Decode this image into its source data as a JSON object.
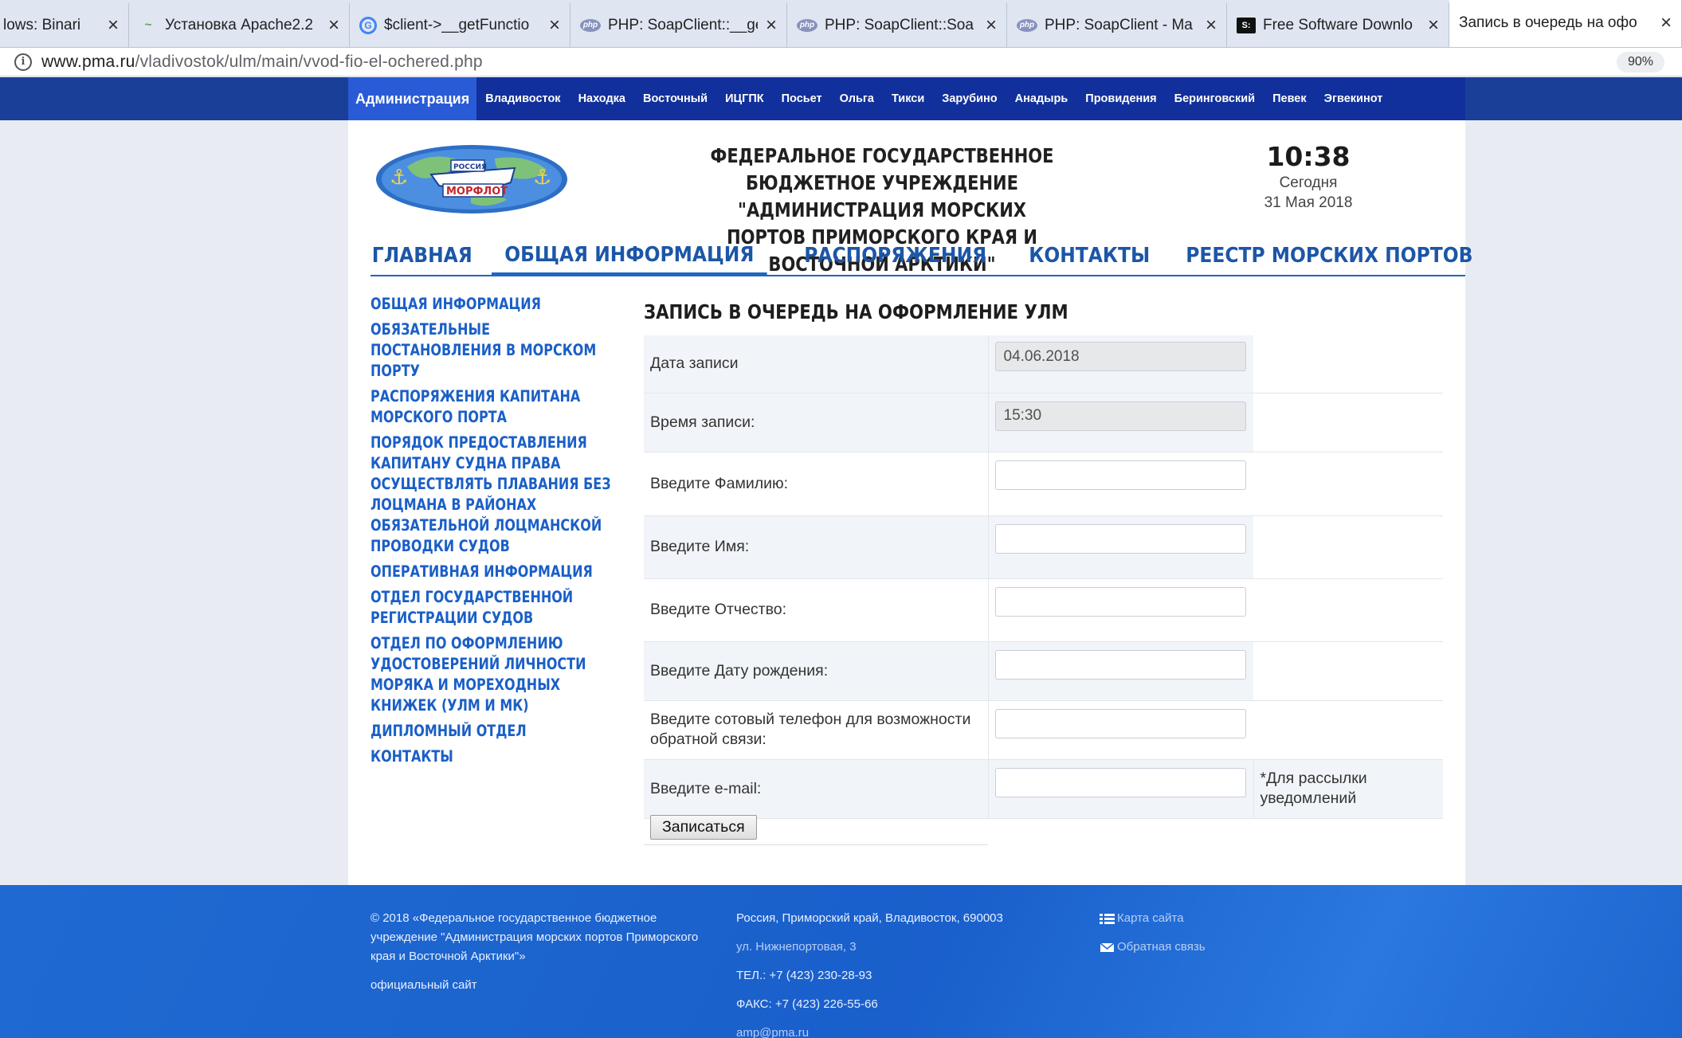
{
  "browser": {
    "tabs": [
      {
        "label": "lows: Binari",
        "favicon": "windows-icon"
      },
      {
        "label": "Установка Apache2.2",
        "favicon": "dash-icon"
      },
      {
        "label": "$client->__getFunctio",
        "favicon": "google-icon"
      },
      {
        "label": "PHP: SoapClient::__ge",
        "favicon": "php-icon"
      },
      {
        "label": "PHP: SoapClient::Soa",
        "favicon": "php-icon"
      },
      {
        "label": "PHP: SoapClient - Ma",
        "favicon": "php-icon"
      },
      {
        "label": "Free Software Downlo",
        "favicon": "sf-icon"
      },
      {
        "label": "Запись в очередь на офо",
        "favicon": "none",
        "active": true
      }
    ],
    "favicon_text": {
      "php": "php",
      "google": "G",
      "sf": "S:"
    },
    "url_host": "www.pma.ru",
    "url_path": "/vladivostok/ulm/main/vvod-fio-el-ochered.php",
    "zoom": "90%"
  },
  "site": {
    "cities": [
      "Администрация",
      "Владивосток",
      "Находка",
      "Восточный",
      "ИЦГПК",
      "Посьет",
      "Ольга",
      "Тикси",
      "Зарубино",
      "Анадырь",
      "Провидения",
      "Беринговский",
      "Певек",
      "Эгвекинот"
    ],
    "logo_text": {
      "top": "РОССИЯ",
      "bottom": "МОРФЛОТ"
    },
    "header_title": "ФЕДЕРАЛЬНОЕ ГОСУДАРСТВЕННОЕ БЮДЖЕТНОЕ УЧРЕЖДЕНИЕ \"АДМИНИСТРАЦИЯ МОРСКИХ ПОРТОВ ПРИМОРСКОГО КРАЯ И ВОСТОЧНОЙ АРКТИКИ\"",
    "clock": {
      "time": "10:38",
      "day": "Сегодня",
      "date": "31 Мая 2018"
    },
    "main_nav": [
      "ГЛАВНАЯ",
      "ОБЩАЯ ИНФОРМАЦИЯ",
      "РАСПОРЯЖЕНИЯ",
      "КОНТАКТЫ",
      "РЕЕСТР МОРСКИХ ПОРТОВ"
    ],
    "main_nav_active": "ОБЩАЯ ИНФОРМАЦИЯ",
    "side_menu": [
      "ОБЩАЯ ИНФОРМАЦИЯ",
      "ОБЯЗАТЕЛЬНЫЕ ПОСТАНОВЛЕНИЯ В МОРСКОМ ПОРТУ",
      "РАСПОРЯЖЕНИЯ КАПИТАНА МОРСКОГО ПОРТА",
      "ПОРЯДОК ПРЕДОСТАВЛЕНИЯ КАПИТАНУ СУДНА ПРАВА ОСУЩЕСТВЛЯТЬ ПЛАВАНИЯ БЕЗ ЛОЦМАНА В РАЙОНАХ ОБЯЗАТЕЛЬНОЙ ЛОЦМАНСКОЙ ПРОВОДКИ СУДОВ",
      "ОПЕРАТИВНАЯ ИНФОРМАЦИЯ",
      "ОТДЕЛ ГОСУДАРСТВЕННОЙ РЕГИСТРАЦИИ СУДОВ",
      "ОТДЕЛ ПО ОФОРМЛЕНИЮ УДОСТОВЕРЕНИЙ ЛИЧНОСТИ МОРЯКА И МОРЕХОДНЫХ КНИЖЕК (УЛМ И МК)",
      "ДИПЛОМНЫЙ ОТДЕЛ",
      "КОНТАКТЫ"
    ]
  },
  "form": {
    "title": "ЗАПИСЬ В ОЧЕРЕДЬ НА ОФОРМЛЕНИЕ УЛМ",
    "rows": [
      {
        "label": "Дата записи",
        "value": "04.06.2018",
        "readonly": true
      },
      {
        "label": "Время записи:",
        "value": "15:30",
        "readonly": true
      },
      {
        "label": "Введите Фамилию:",
        "value": ""
      },
      {
        "label": "Введите Имя:",
        "value": ""
      },
      {
        "label": "Введите Отчество:",
        "value": ""
      },
      {
        "label": "Введите Дату рождения:",
        "value": ""
      },
      {
        "label": "Введите сотовый телефон для возможности обратной связи:",
        "value": ""
      },
      {
        "label": "Введите e-mail:",
        "value": "",
        "note": "*Для рассылки уведомлений"
      }
    ],
    "submit_label": "Записаться"
  },
  "footer": {
    "copyright": "© 2018 «Федеральное государственное бюджетное учреждение \"Администрация морских портов Приморского края и Восточной Арктики\"»",
    "official": "официальный сайт",
    "address": "Россия, Приморский край, Владивосток, 690003",
    "street": "ул. Нижнепортовая, 3",
    "phone": "ТЕЛ.: +7 (423) 230-28-93",
    "fax": "ФАКС: +7 (423) 226-55-66",
    "email": "amp@pma.ru",
    "sitemap": "Карта сайта",
    "feedback": "Обратная связь"
  },
  "colors": {
    "nav_blue": "#12309b",
    "nav_active": "#2a5bd7",
    "link_blue": "#1a5fc7",
    "footer_blue": "#1f6ad2"
  }
}
